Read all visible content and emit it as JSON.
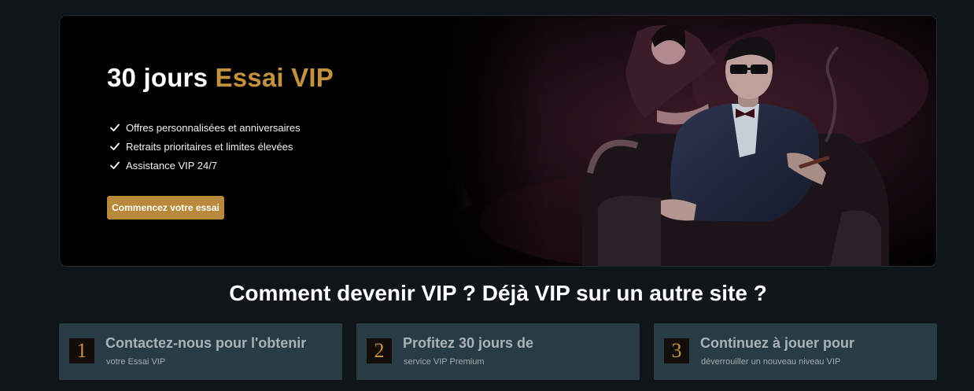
{
  "hero": {
    "title_lead": "30 jours",
    "title_accent": "Essai VIP",
    "benefits": [
      "Offres personnalisées et anniversaires",
      "Retraits prioritaires et limites élevées",
      "Assistance VIP 24/7"
    ],
    "cta_label": "Commencez votre essai"
  },
  "how_to": {
    "heading": "Comment devenir VIP ? Déjà VIP sur un autre site ?",
    "steps": [
      {
        "number": "1",
        "title": "Contactez-nous pour l'obtenir",
        "subtitle": "votre Essai VIP"
      },
      {
        "number": "2",
        "title": "Profitez 30 jours de",
        "subtitle": "service VIP Premium"
      },
      {
        "number": "3",
        "title": "Continuez à jouer pour",
        "subtitle": "déverrouiller un nouveau niveau VIP"
      }
    ]
  },
  "colors": {
    "page_background": "#0f1518",
    "accent_gold": "#c4923e",
    "button_gold": "#b8893a",
    "step_card": "#283c45"
  },
  "icons": {
    "benefit_marker": "check-icon"
  }
}
